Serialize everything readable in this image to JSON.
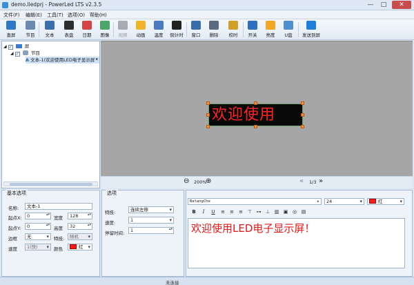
{
  "window": {
    "title": "demo.lledprj - PowerLed LTS v2.3.5",
    "min": "—",
    "max": "□",
    "close": "✕"
  },
  "menu": [
    "文件(F)",
    "编辑(E)",
    "工具(T)",
    "选项(O)",
    "帮助(H)"
  ],
  "toolbar": {
    "items": [
      {
        "label": "查屏",
        "icon": "search-screen-icon",
        "color": "#2f79c8",
        "disabled": false
      },
      {
        "label": "节目",
        "icon": "program-gear-icon",
        "color": "#6a8bb0",
        "disabled": false
      },
      {
        "label": "文本",
        "icon": "text-icon",
        "color": "#3b6fb0",
        "disabled": false
      },
      {
        "label": "表盘",
        "icon": "clock-dial-icon",
        "color": "#2d2d2d",
        "disabled": false
      },
      {
        "label": "日期",
        "icon": "calendar-icon",
        "color": "#d64545",
        "disabled": false
      },
      {
        "label": "图像",
        "icon": "image-icon",
        "color": "#4aa66b",
        "disabled": false
      },
      {
        "label": "视频",
        "icon": "video-icon",
        "color": "#555555",
        "disabled": true
      },
      {
        "label": "动画",
        "icon": "animation-icon",
        "color": "#f0b428",
        "disabled": false
      },
      {
        "label": "温度",
        "icon": "temperature-icon",
        "color": "#4c7ac0",
        "disabled": false
      },
      {
        "label": "倒计时",
        "icon": "countdown-icon",
        "color": "#222222",
        "disabled": false
      },
      {
        "label": "窗口",
        "icon": "window-icon",
        "color": "#3a6ea8",
        "disabled": false
      },
      {
        "label": "删除",
        "icon": "trash-icon",
        "color": "#5a6a80",
        "disabled": false
      },
      {
        "label": "校时",
        "icon": "time-sync-icon",
        "color": "#d0a02a",
        "disabled": false
      },
      {
        "label": "开关",
        "icon": "power-icon",
        "color": "#2f6fc0",
        "disabled": false
      },
      {
        "label": "亮度",
        "icon": "brightness-icon",
        "color": "#f4a623",
        "disabled": false
      },
      {
        "label": "U盘",
        "icon": "usb-icon",
        "color": "#4f8fd0",
        "disabled": false
      },
      {
        "label": "发送到屏",
        "icon": "send-icon",
        "color": "#1f7fd8",
        "disabled": false
      }
    ]
  },
  "tree": {
    "screen": "屏",
    "program": "节目",
    "item": "文本-1(欢迎使用LED电子显示屏"
  },
  "preview": {
    "led_text": "欢迎使用",
    "zoom": "200%",
    "page": "1/3",
    "led_color": "#ff2424"
  },
  "basic": {
    "title": "基本选项",
    "name_label": "名称:",
    "name_value": "文本-1",
    "x_label": "起点X:",
    "x_value": "0",
    "width_label": "宽度",
    "width_value": "128",
    "y_label": "起点Y:",
    "y_value": "0",
    "height_label": "高度",
    "height_value": "32",
    "border_label": "边框",
    "border_value": "无",
    "effect_label": "特技:",
    "effect_value": "随机",
    "speed_label": "速度",
    "speed_value": "1(快)",
    "color_label": "颜色",
    "color_value": "红"
  },
  "options": {
    "title": "选项",
    "effect_label": "特技:",
    "effect_value": "连续左移",
    "speed_label": "速度:",
    "speed_value": "1",
    "stay_label": "停留时间:",
    "stay_value": "1"
  },
  "format": {
    "font": "BatangChe",
    "size": "24",
    "color": "红",
    "bold": "B",
    "italic": "I",
    "underline": "U"
  },
  "editor": {
    "text": "欢迎使用LED电子显示屏！"
  },
  "status": "未连接"
}
